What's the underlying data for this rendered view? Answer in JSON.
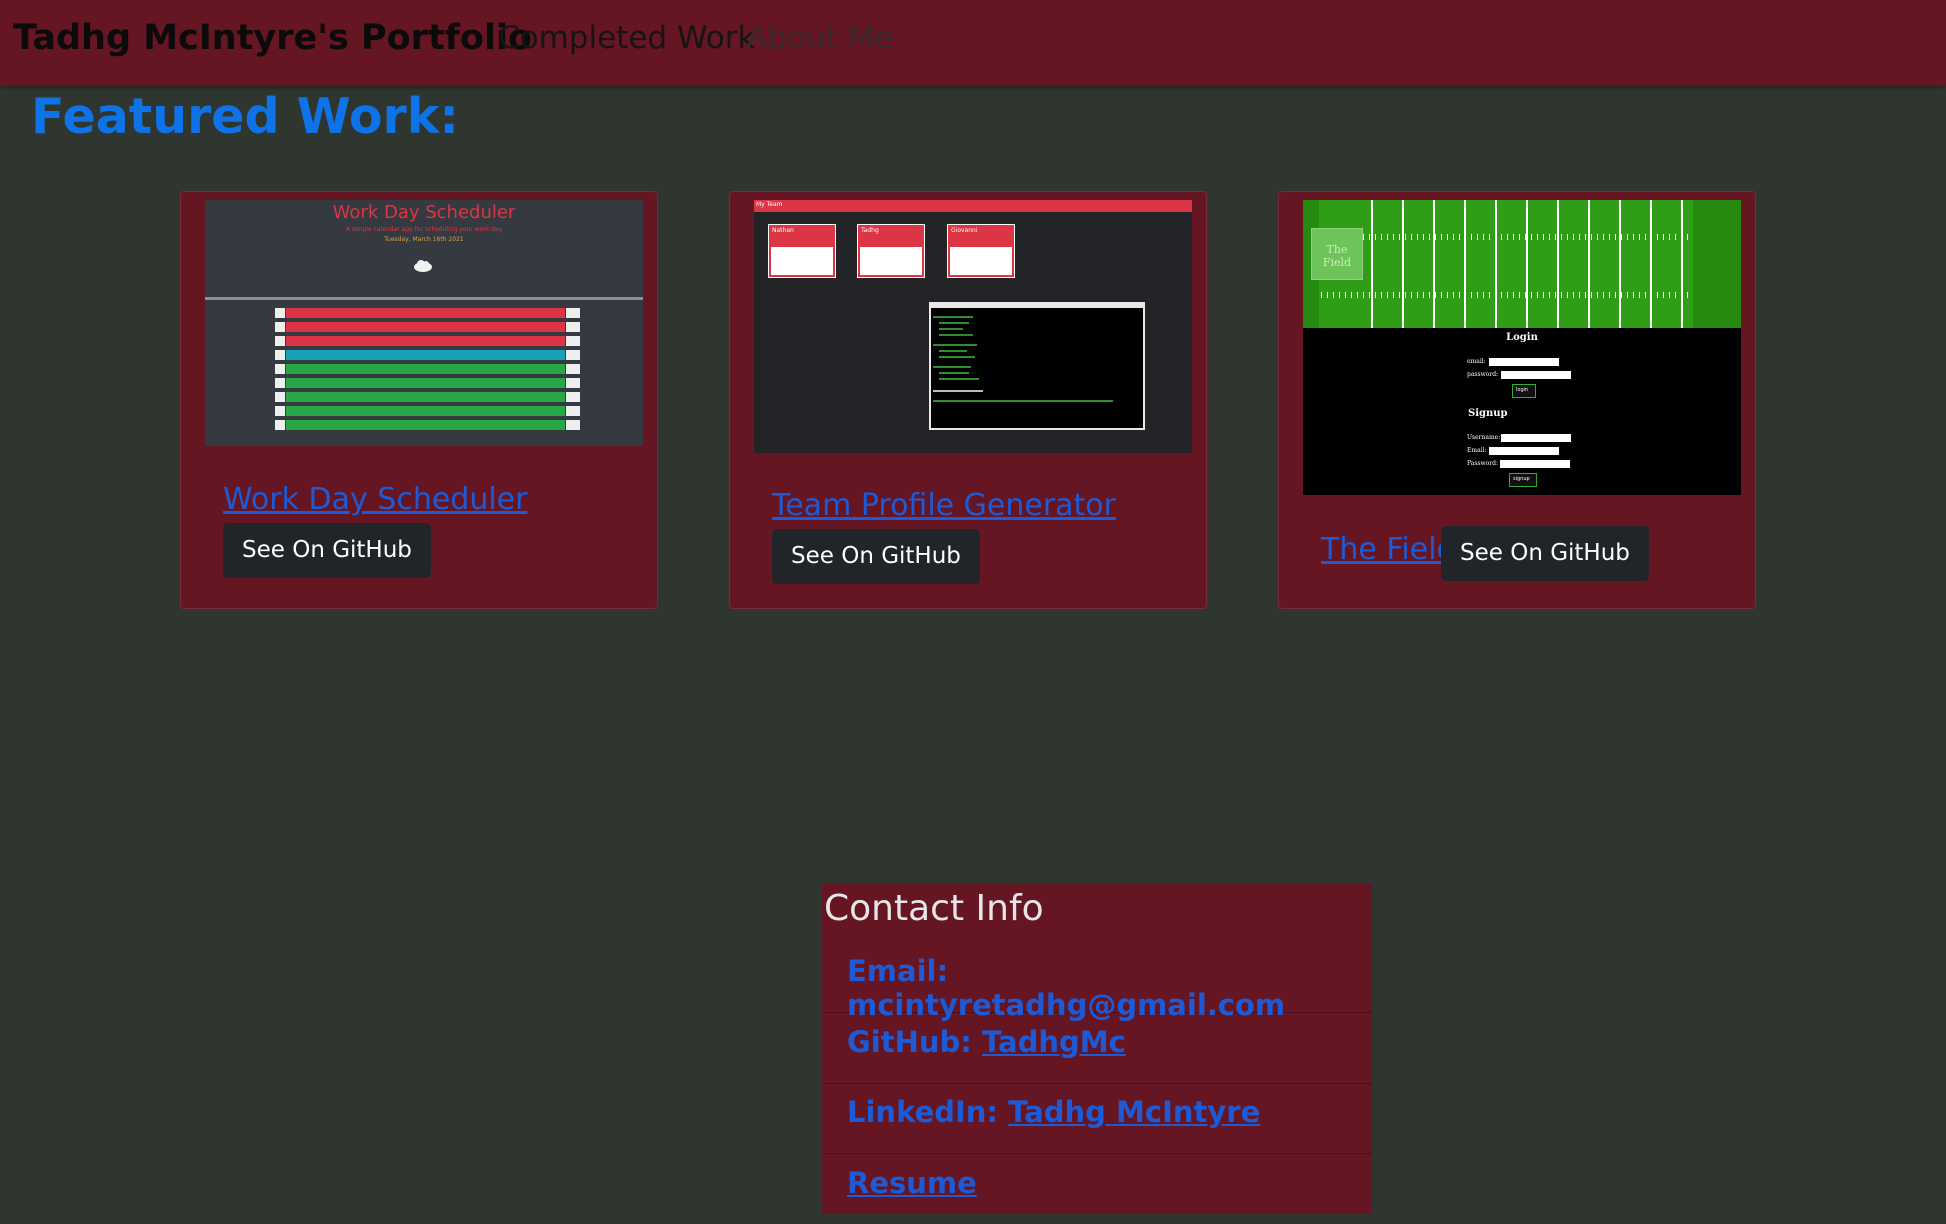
{
  "navbar": {
    "brand": "Tadhg McIntyre's Portfolio",
    "links": [
      "Completed Work",
      "About Me"
    ]
  },
  "featured": {
    "heading": "Featured Work:"
  },
  "projects": [
    {
      "title": "Work Day Scheduler",
      "button": "See On GitHub",
      "thumb": {
        "title": "Work Day Scheduler",
        "subtitle": "A simple calendar app for scheduling your work day",
        "date": "Tuesday, March 16th 2021",
        "row_colors": [
          "#dc3545",
          "#dc3545",
          "#dc3545",
          "#17a2b8",
          "#28a745",
          "#28a745",
          "#28a745",
          "#28a745",
          "#28a745"
        ]
      }
    },
    {
      "title": "Team Profile Generator",
      "button": "See On GitHub",
      "thumb": {
        "header": "My Team",
        "members": [
          "Nathan",
          "Tadhg",
          "Giovanni"
        ]
      }
    },
    {
      "title": "The Field",
      "button": "See On GitHub",
      "thumb": {
        "logo": "The Field",
        "login_heading": "Login",
        "email_label": "email:",
        "password_label": "password:",
        "login_button": "login",
        "signup_heading": "Signup",
        "username_label": "Username:",
        "signup_email_label": "Email:",
        "signup_password_label": "Password:",
        "signup_button": "signup"
      }
    }
  ],
  "contact": {
    "title": "Contact Info",
    "email": "Email: mcintyretadhg@gmail.com",
    "github_label": "GitHub:",
    "github_link": "TadhgMc",
    "linkedin_label": "LinkedIn:",
    "linkedin_link": "Tadhg McIntyre",
    "resume_link": "Resume"
  },
  "colors": {
    "page_bg": "#2f362f",
    "navbar_bg": "#661522",
    "card_bg": "#661522",
    "heading_blue": "#0e73e6",
    "link_blue": "#1d5ad6",
    "button_bg": "#212529"
  }
}
